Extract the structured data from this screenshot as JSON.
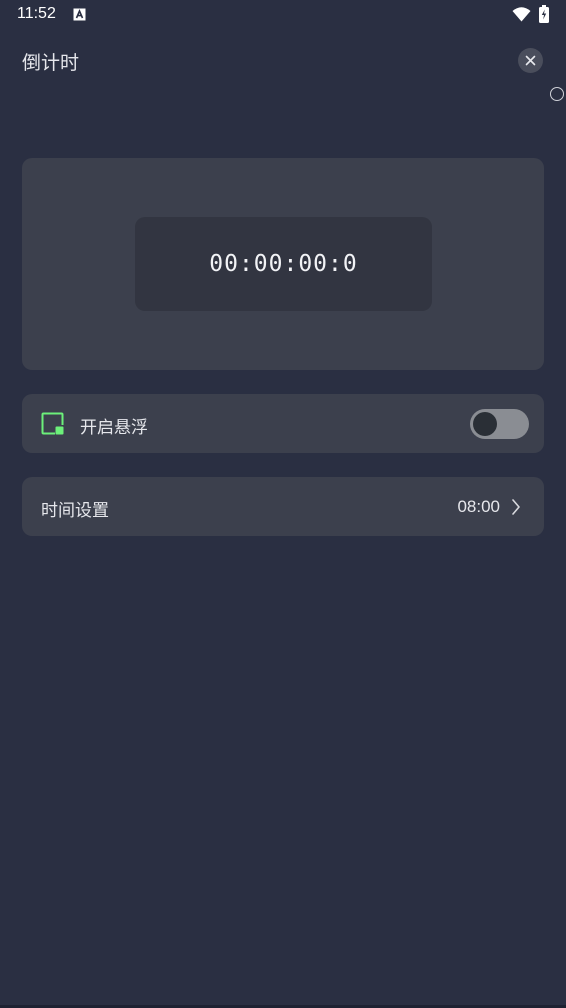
{
  "status_bar": {
    "time": "11:52",
    "icons": [
      "a-notification-icon",
      "wifi-icon",
      "battery-charging-icon"
    ]
  },
  "header": {
    "title": "倒计时",
    "close_icon": "close-icon"
  },
  "timer": {
    "value": "00:00:00:0"
  },
  "float_row": {
    "label": "开启悬浮",
    "icon": "float-window-icon",
    "enabled": false,
    "accent_color": "#6cf07a"
  },
  "time_setting": {
    "label": "时间设置",
    "value": "08:00",
    "icon": "chevron-right-icon"
  },
  "colors": {
    "background": "#2a2f42",
    "card": "#3c404d",
    "display": "#323541"
  }
}
